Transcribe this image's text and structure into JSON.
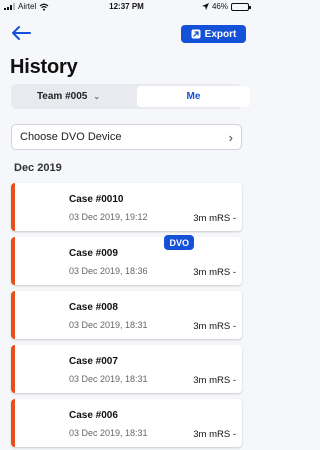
{
  "status_bar": {
    "carrier": "Airtel",
    "time": "12:37 PM",
    "battery": "46%",
    "battery_level": 0.46
  },
  "header": {
    "back_icon": "arrow-left-icon",
    "export_label": "Export",
    "export_icon": "export-icon",
    "title": "History"
  },
  "segments": {
    "team_label": "Team #005",
    "me_label": "Me",
    "selected": "Me"
  },
  "dvo_select": {
    "placeholder": "Choose DVO Device"
  },
  "section": {
    "month_label": "Dec 2019"
  },
  "cases": [
    {
      "title": "Case #0010",
      "date": "03 Dec 2019, 19:12",
      "score": "3m mRS -",
      "badge": ""
    },
    {
      "title": "Case #009",
      "date": "03 Dec 2019, 18:36",
      "score": "3m mRS -",
      "badge": "DVO"
    },
    {
      "title": "Case #008",
      "date": "03 Dec 2019, 18:31",
      "score": "3m mRS -",
      "badge": ""
    },
    {
      "title": "Case #007",
      "date": "03 Dec 2019, 18:31",
      "score": "3m mRS -",
      "badge": ""
    },
    {
      "title": "Case #006",
      "date": "03 Dec 2019, 18:31",
      "score": "3m mRS -",
      "badge": ""
    }
  ],
  "colors": {
    "accent": "#1450d8",
    "case_stripe": "#e8501a"
  }
}
